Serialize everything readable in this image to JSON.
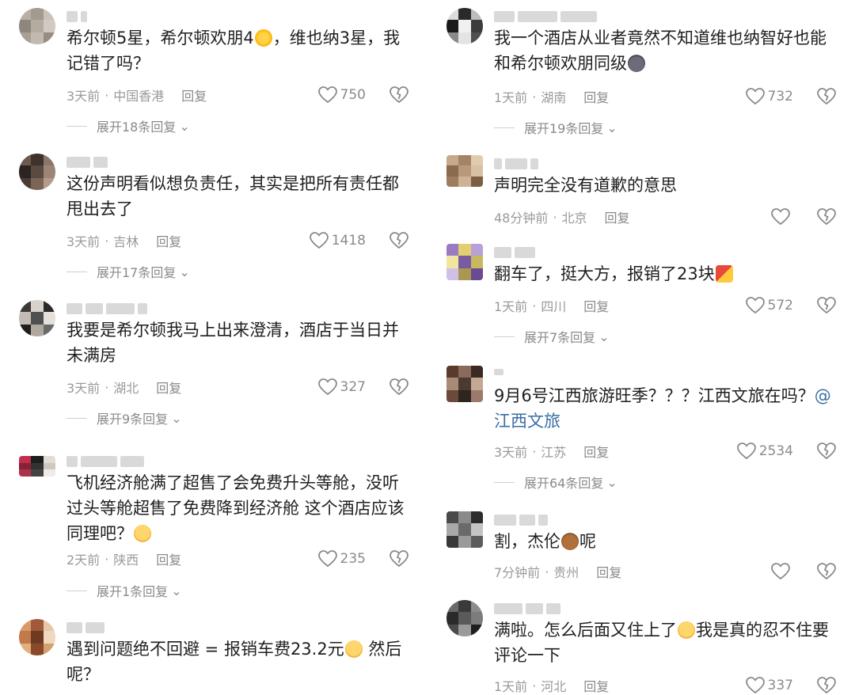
{
  "left": [
    {
      "text": "希尔顿5星，希尔顿欢朋4",
      "text2": "，维也纳3星，我记错了吗？",
      "time": "3天前",
      "region": "中国香港",
      "reply": "回复",
      "likes": "750",
      "expand": "展开18条回复",
      "avatar": [
        "#b8b0a4",
        "#a39a90",
        "#cbc3ba",
        "#8f877d",
        "#b5aca1",
        "#d1cac2",
        "#a8a095",
        "#c2bab0",
        "#958d83"
      ]
    },
    {
      "text": "这份声明看似想负责任，其实是把所有责任都甩出去了",
      "time": "3天前",
      "region": "吉林",
      "reply": "回复",
      "likes": "1418",
      "expand": "展开17条回复",
      "avatar": [
        "#6d5a4e",
        "#3d322c",
        "#8b7567",
        "#2c2421",
        "#5a4a40",
        "#9c8576",
        "#4a3c34",
        "#7a6556",
        "#b39c8c"
      ]
    },
    {
      "text": "我要是希尔顿我马上出来澄清，酒店于当日并未满房",
      "time": "3天前",
      "region": "湖北",
      "reply": "回复",
      "likes": "327",
      "expand": "展开9条回复",
      "avatar": [
        "#3a3a3a",
        "#d8d2cc",
        "#2a2a2a",
        "#c4bcb4",
        "#505050",
        "#e6e0da",
        "#1f1f1f",
        "#b0a89f",
        "#6a6a6a"
      ]
    },
    {
      "text": "飞机经济舱满了超售了会免费升头等舱，没听过头等舱超售了免费降到经济舱  这个酒店应该同理吧？",
      "time": "2天前",
      "region": "陕西",
      "reply": "回复",
      "likes": "235",
      "expand": "展开1条回复",
      "avatar": [
        "#c0304a",
        "#1d1d1d",
        "#e2dcd6",
        "#8a2035",
        "#333",
        "#cfc8c0",
        "#aa3348",
        "#444",
        "#f0ebe6"
      ]
    },
    {
      "text": "遇到问题绝不回避 = 报销车费23.2元",
      "text2": "  然后呢？",
      "time": "",
      "region": "",
      "reply": "",
      "likes": "",
      "expand": "",
      "avatar": [
        "#d99a6a",
        "#a05a3a",
        "#e8c6a8",
        "#c17a4a",
        "#6e3a22",
        "#f0d8c0",
        "#e0b080",
        "#8a4a2a",
        "#d4a070"
      ]
    }
  ],
  "right": [
    {
      "text": "我一个酒店从业者竟然不知道维也纳智好也能和希尔顿欢朋同级",
      "time": "1天前",
      "region": "湖南",
      "reply": "回复",
      "likes": "732",
      "expand": "展开19条回复",
      "avatar": [
        "#dcdcdc",
        "#2a2a2a",
        "#bdbdbd",
        "#1a1a1a",
        "#f0f0f0",
        "#3c3c3c",
        "#8a8a8a",
        "#e4e4e4",
        "#505050"
      ]
    },
    {
      "text": "声明完全没有道歉的意思",
      "time": "48分钟前",
      "region": "北京",
      "reply": "回复",
      "likes": "",
      "expand": "",
      "avatar": [
        "#c6a98a",
        "#a48464",
        "#e1cbb0",
        "#8c6a4c",
        "#b89a7a",
        "#d8c0a4",
        "#9d7d5e",
        "#cdb295",
        "#7e5e42"
      ]
    },
    {
      "text": "翻车了，挺大方，报销了23块",
      "time": "1天前",
      "region": "四川",
      "reply": "回复",
      "likes": "572",
      "expand": "展开7条回复",
      "avatar": [
        "#9a7ac0",
        "#e0d070",
        "#b8a0d8",
        "#f0e6a0",
        "#7a5aa0",
        "#c8b860",
        "#d0c0e8",
        "#a89850",
        "#6a4a90"
      ]
    },
    {
      "text": "9月6号江西旅游旺季？？？江西文旅在吗？",
      "mention": "@江西文旅",
      "time": "3天前",
      "region": "江苏",
      "reply": "回复",
      "likes": "2534",
      "expand": "展开64条回复",
      "avatar": [
        "#5a3a2a",
        "#8a6a5a",
        "#3a2a22",
        "#a88a78",
        "#4a3a30",
        "#c4a894",
        "#6a4a3a",
        "#2e2420",
        "#9a7a68"
      ]
    },
    {
      "text": "割，杰伦",
      "text2": "呢",
      "time": "7分钟前",
      "region": "贵州",
      "reply": "回复",
      "likes": "",
      "expand": "",
      "avatar": [
        "#4a4a4a",
        "#8a8a8a",
        "#2c2c2c",
        "#a8a8a8",
        "#6a6a6a",
        "#c4c4c4",
        "#383838",
        "#9a9a9a",
        "#5c5c5c"
      ]
    },
    {
      "text": "满啦。怎么后面又住上了",
      "text2": "我是真的忍不住要评论一下",
      "time": "1天前",
      "region": "河北",
      "reply": "回复",
      "likes": "337",
      "expand": "",
      "avatar": [
        "#6a6a6a",
        "#3a3a3a",
        "#8c8c8c",
        "#2a2a2a",
        "#5a5a5a",
        "#7c7c7c",
        "#4a4a4a",
        "#9a9a9a",
        "#1e1e1e"
      ]
    }
  ],
  "colors": {
    "meta": "#9a9a9a",
    "mention": "#3a6ea5",
    "text": "#1f1f1f"
  }
}
